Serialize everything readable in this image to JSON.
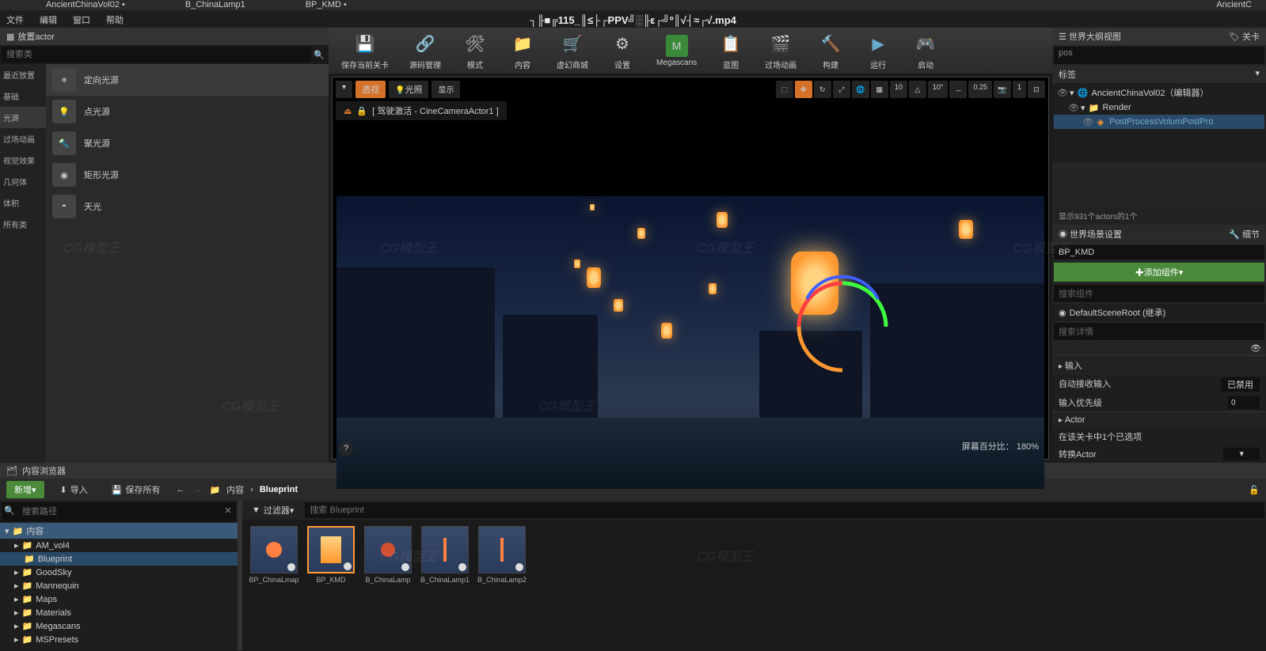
{
  "tabs": [
    "AncientChinaVol02 •",
    "B_ChinaLamp1",
    "BP_KMD •"
  ],
  "title_right": "AncientC",
  "menu": [
    "文件",
    "编辑",
    "窗口",
    "帮助"
  ],
  "window_title": "┐╟■╔115_║≤├┌PPV╝░╟ε┌╝º║√┤≈┌√.mp4",
  "place_actor": {
    "header": "放置actor",
    "search_placeholder": "搜索类",
    "categories": [
      "最近放置",
      "基础",
      "光源",
      "过场动画",
      "视觉效果",
      "几何体",
      "体积",
      "所有类"
    ],
    "lights": [
      "定向光源",
      "点光源",
      "聚光源",
      "矩形光源",
      "天光"
    ]
  },
  "toolbar": {
    "save": "保存当前关卡",
    "source": "源码管理",
    "mode": "模式",
    "content": "内容",
    "market": "虚幻商城",
    "settings": "设置",
    "megascans": "Megascans",
    "blueprint": "蓝图",
    "cinematics": "过场动画",
    "build": "构建",
    "play": "运行",
    "launch": "启动"
  },
  "viewport": {
    "perspective": "透视",
    "lit": "光照",
    "show": "显示",
    "camera_label": "[ 驾驶激活 - CineCameraActor1 ]",
    "snap_nums": [
      "10",
      "10°",
      "0.25",
      "1"
    ],
    "zoom": "屏幕百分比：  180%"
  },
  "outliner": {
    "header": "世界大纲视图",
    "level_label": "关卡",
    "search_value": "pos",
    "col_label": "标签",
    "items": [
      {
        "name": "AncientChinaVol02（编辑器）",
        "lv": 0
      },
      {
        "name": "Render",
        "lv": 1
      },
      {
        "name": "PostProcessVolumPostPro",
        "lv": 2,
        "sel": true
      }
    ],
    "actor_count": "显示931个actors的1个"
  },
  "details": {
    "world_settings": "世界场景设置",
    "detail_btn": "细节",
    "actor_name": "BP_KMD",
    "add_component": "✚添加组件▾",
    "search_component": "搜索组件",
    "root_item": "DefaultSceneRoot (继承)",
    "search_detail": "搜索详情",
    "input_section": "输入",
    "auto_input": "自动接收输入",
    "auto_input_val": "已禁用",
    "input_priority": "输入优先级",
    "input_priority_val": "0",
    "actor_section": "Actor",
    "actor_hint": "在该关卡中1个已选项",
    "convert_actor": "转换Actor"
  },
  "content_browser": {
    "header": "内容浏览器",
    "new": "新增▾",
    "import": "导入",
    "save_all": "保存所有",
    "path_content": "内容",
    "path_blueprint": "Blueprint",
    "tree_search": "搜索路径",
    "filter": "过滤器▾",
    "asset_search": "搜索 Blueprint",
    "folders": [
      {
        "name": "内容",
        "lv": 0,
        "sel": true
      },
      {
        "name": "AM_vol4",
        "lv": 1
      },
      {
        "name": "Blueprint",
        "lv": 1,
        "sel2": true
      },
      {
        "name": "GoodSky",
        "lv": 1
      },
      {
        "name": "Mannequin",
        "lv": 1
      },
      {
        "name": "Maps",
        "lv": 1
      },
      {
        "name": "Materials",
        "lv": 1
      },
      {
        "name": "Megascans",
        "lv": 1
      },
      {
        "name": "MSPresets",
        "lv": 1
      }
    ],
    "assets": [
      {
        "name": "BP_ChinaLmap"
      },
      {
        "name": "BP_KMD",
        "sel": true
      },
      {
        "name": "B_ChinaLamp"
      },
      {
        "name": "B_ChinaLamp1"
      },
      {
        "name": "B_ChinaLamp2"
      }
    ]
  }
}
